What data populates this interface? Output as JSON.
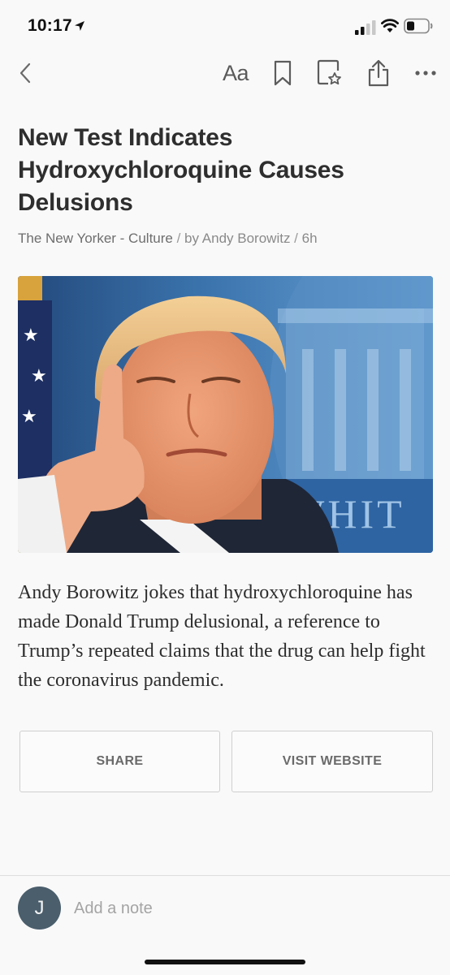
{
  "status_bar": {
    "time": "10:17",
    "location_icon": "location-arrow-icon",
    "signal_icon": "cellular-signal-icon",
    "wifi_icon": "wifi-icon",
    "battery_icon": "battery-icon"
  },
  "toolbar": {
    "back_icon": "chevron-left-icon",
    "font_label": "Aa",
    "bookmark_icon": "bookmark-icon",
    "favorite_icon": "document-star-icon",
    "share_icon": "share-icon",
    "more_icon": "ellipsis-icon"
  },
  "article": {
    "title": "New Test Indicates Hydroxychloroquine Causes Delusions",
    "source": "The New Yorker - Culture",
    "separator": " / ",
    "author": "by Andy Borowitz",
    "age": "6h",
    "image_banner_text": "E WHIT",
    "summary": "Andy Borowitz jokes that hydroxychloroquine has made Donald Trump delusional, a reference to Trump’s repeated claims that the drug can help fight the coronavirus pandemic."
  },
  "actions": {
    "share_label": "SHARE",
    "visit_label": "VISIT WEBSITE"
  },
  "note": {
    "avatar_initial": "J",
    "placeholder": "Add a note"
  },
  "colors": {
    "background": "#f9f9f9",
    "title": "#2e2e2e",
    "byline": "#8a8a8a",
    "button_border": "#cfcfcf",
    "avatar": "#4a5e6c"
  }
}
